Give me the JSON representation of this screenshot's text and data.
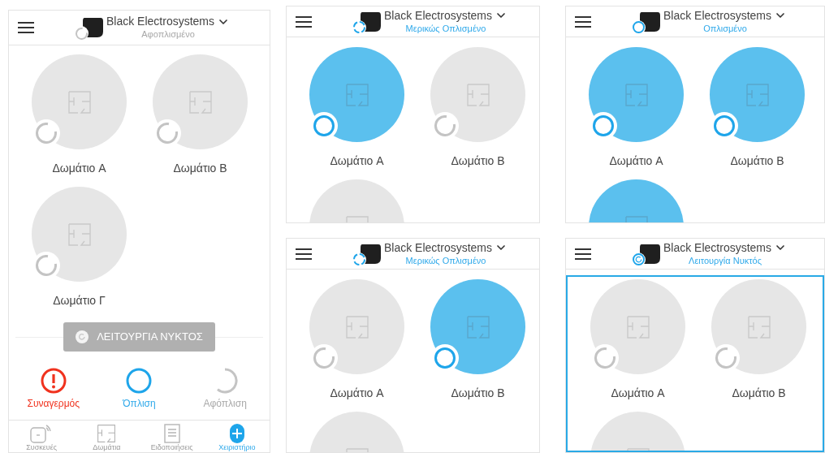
{
  "screens": [
    {
      "hub": {
        "name": "Black Electrosystems",
        "status": "Αφοπλισμένο",
        "kind": "disarmed"
      },
      "rooms": [
        {
          "name": "Δωμάτιο A",
          "armed": false
        },
        {
          "name": "Δωμάτιο B",
          "armed": false
        },
        {
          "name": "Δωμάτιο Γ",
          "armed": false
        }
      ],
      "night_button": {
        "label": "ΛΕΙΤΟΥΡΓΙΑ ΝΥΚΤΟΣ",
        "disabled": true
      },
      "actions": [
        {
          "label": "Συναγερμός",
          "kind": "alarm"
        },
        {
          "label": "Όπλιση",
          "kind": "arm"
        },
        {
          "label": "Αφόπλιση",
          "kind": "disarm"
        }
      ],
      "nav": [
        {
          "label": "Συσκευές",
          "kind": "devices",
          "selected": false
        },
        {
          "label": "Δωμάτια",
          "kind": "rooms",
          "selected": false
        },
        {
          "label": "Ειδοποιήσεις",
          "kind": "notifications",
          "selected": false
        },
        {
          "label": "Χειριστήριο",
          "kind": "control",
          "selected": true
        }
      ]
    },
    {
      "hub": {
        "name": "Black Electrosystems",
        "status": "Μερικώς Οπλισμένο",
        "kind": "partial"
      },
      "focused": false,
      "rooms": [
        {
          "name": "Δωμάτιο A",
          "armed": true
        },
        {
          "name": "Δωμάτιο B",
          "armed": false
        },
        {
          "armed": false
        }
      ]
    },
    {
      "hub": {
        "name": "Black Electrosystems",
        "status": "Οπλισμένο",
        "kind": "armed"
      },
      "focused": false,
      "rooms": [
        {
          "name": "Δωμάτιο A",
          "armed": true
        },
        {
          "name": "Δωμάτιο B",
          "armed": true
        },
        {
          "armed": true
        }
      ]
    },
    {
      "hub": {
        "name": "Black Electrosystems",
        "status": "Μερικώς Οπλισμένο",
        "kind": "partial"
      },
      "focused": false,
      "rooms": [
        {
          "name": "Δωμάτιο A",
          "armed": false
        },
        {
          "name": "Δωμάτιο B",
          "armed": true
        },
        {
          "armed": false
        }
      ]
    },
    {
      "hub": {
        "name": "Black Electrosystems",
        "status": "Λειτουργία Νυκτός",
        "kind": "night"
      },
      "focused": true,
      "rooms": [
        {
          "name": "Δωμάτιο A",
          "armed": false
        },
        {
          "name": "Δωμάτιο B",
          "armed": false
        },
        {
          "armed": false
        }
      ]
    }
  ]
}
